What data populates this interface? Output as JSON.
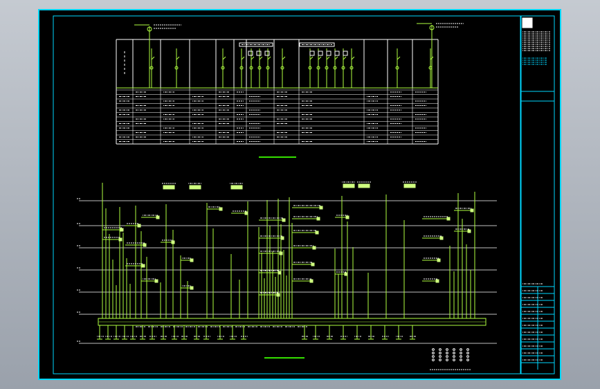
{
  "colors": {
    "background": "#000000",
    "frame": "#00d8ff",
    "table": "#ffffff",
    "wiring": "#b0ff40",
    "accent": "#35e000",
    "blockFill": "#cfff80"
  },
  "upper_diagram": {
    "panel_count": 13,
    "table_rows": 12
  },
  "lower_diagram": {
    "floor_levels": 7,
    "feeder_count": 58
  }
}
